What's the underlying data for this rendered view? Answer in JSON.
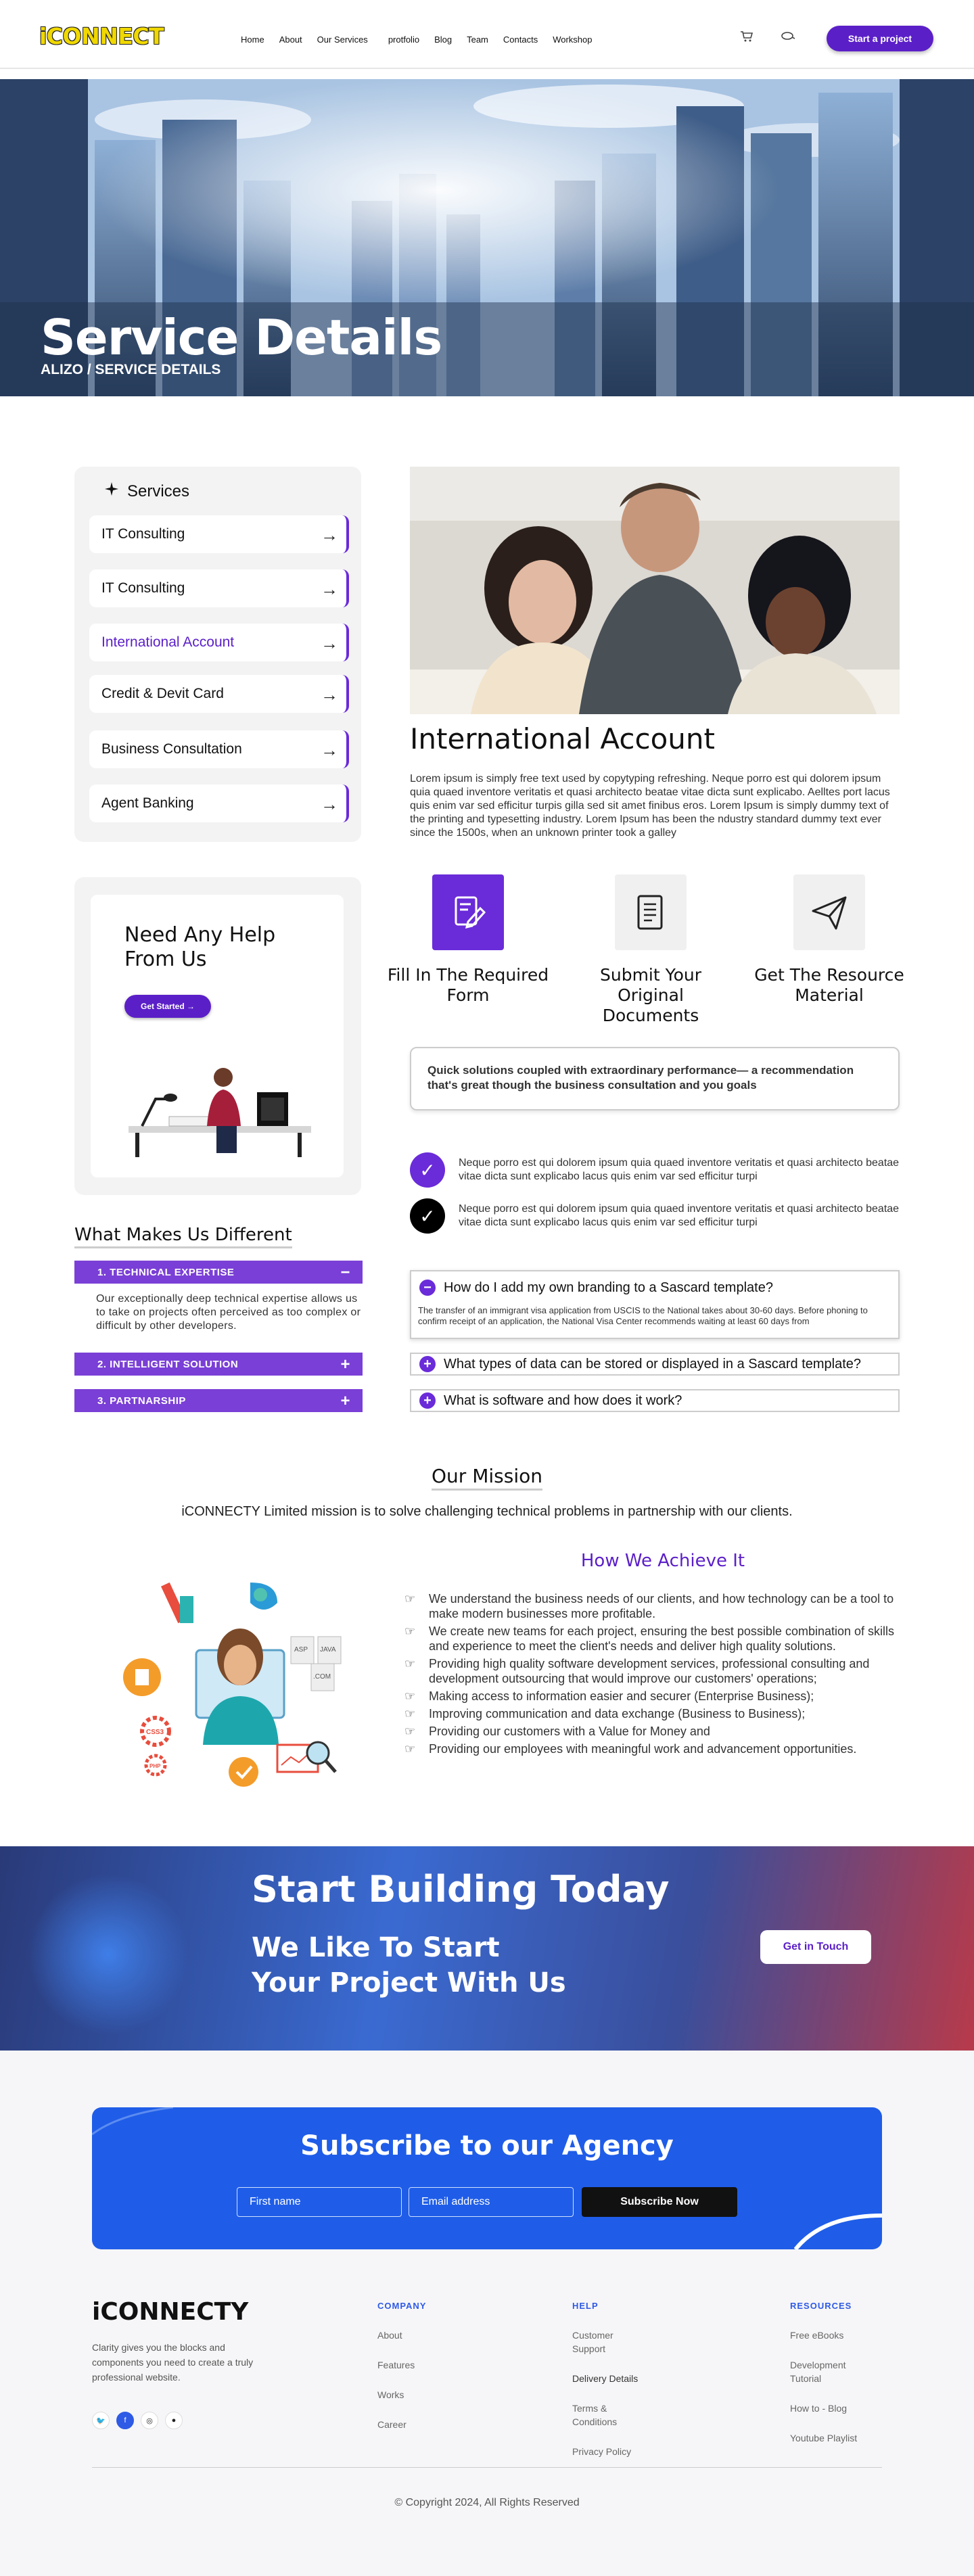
{
  "header": {
    "logo": "iCONNECT",
    "nav": [
      "Home",
      "About",
      "Our Services",
      "protfolio",
      "Blog",
      "Team",
      "Contacts",
      "Workshop"
    ],
    "cta": "Start a project",
    "icons": [
      "cart-icon",
      "search-icon"
    ]
  },
  "hero": {
    "title": "Service Details",
    "breadcrumb": "ALIZO / SERVICE DETAILS"
  },
  "services": {
    "title": "Services",
    "items": [
      {
        "label": "IT Consulting"
      },
      {
        "label": "IT Consulting"
      },
      {
        "label": "International Account",
        "active": true
      },
      {
        "label": "Credit & Devit Card"
      },
      {
        "label": "Business Consultation"
      },
      {
        "label": "Agent Banking"
      }
    ]
  },
  "help": {
    "title": "Need Any Help From Us",
    "button": "Get Started"
  },
  "main": {
    "title": "International Account",
    "paragraph": "Lorem ipsum is simply free text used by copytyping refreshing. Neque porro est qui dolorem ipsum quia quaed inventore veritatis et quasi architecto beatae vitae dicta sunt explicabo. Aelltes port lacus quis enim var sed efficitur turpis gilla sed sit amet finibus eros. Lorem Ipsum is simply dummy text of the printing and typesetting industry. Lorem Ipsum has been the ndustry standard dummy text ever since the 1500s, when an unknown printer took a galley",
    "steps": [
      {
        "title": "Fill In The Required Form",
        "icon": "form-icon"
      },
      {
        "title": "Submit Your Original Documents",
        "icon": "document-icon"
      },
      {
        "title": "Get The Resource Material",
        "icon": "paper-plane-icon"
      }
    ],
    "quote": "Quick solutions coupled with extraordinary performance— a recommendation that's great though the business consultation and you goals",
    "checks": [
      "Neque porro est qui dolorem ipsum quia quaed inventore veritatis et quasi architecto beatae vitae dicta sunt explicabo lacus quis enim var sed efficitur turpi",
      "Neque porro est qui dolorem ipsum quia quaed inventore veritatis et quasi architecto beatae vitae dicta sunt explicabo lacus quis enim var sed efficitur turpi"
    ],
    "faq": [
      {
        "q": "How do I add my own branding to a Sascard template?",
        "a": "The transfer of an immigrant visa application from USCIS to the National takes about 30-60 days. Before phoning to confirm receipt of an application, the National Visa Center recommends waiting at least 60 days from",
        "open": true
      },
      {
        "q": "What types of data can be stored or displayed in a Sascard template?"
      },
      {
        "q": "What is software and how does it work?"
      }
    ]
  },
  "different": {
    "title": "What Makes Us Different",
    "items": [
      {
        "label": "1.  TECHNICAL EXPERTISE",
        "open": true,
        "body": "Our exceptionally deep technical expertise allows us to take on projects often perceived as too complex or difficult by other developers."
      },
      {
        "label": "2.  INTELLIGENT SOLUTION"
      },
      {
        "label": "3.  PARTNARSHIP"
      }
    ]
  },
  "mission": {
    "title": "Our Mission",
    "text": "iCONNECTY Limited mission is to solve challenging technical problems in partnership with our clients.",
    "achieve_title": "How We Achieve It",
    "achieve": [
      "We understand the business needs of our clients, and how technology can be a tool to make modern businesses more profitable.",
      "We create new teams for each project, ensuring the best possible combination of skills and experience to meet the client's needs and deliver high quality solutions.",
      "Providing high quality software development services, professional consulting and development outsourcing that would improve our customers' operations;",
      "Making access to information easier and securer (Enterprise Business);",
      "Improving communication and data exchange (Business to Business);",
      "Providing our customers with a Value for Money and",
      "Providing our employees with meaningful work and advancement opportunities."
    ],
    "illustration_labels": [
      "ASP",
      "JAVA",
      ".COM",
      "CSS3",
      "PHP"
    ]
  },
  "banner": {
    "title": "Start Building Today",
    "subtitle": "We Like To Start Your Project With Us",
    "button": "Get in Touch"
  },
  "subscribe": {
    "title": "Subscribe to our Agency",
    "first_placeholder": "First name",
    "email_placeholder": "Email address",
    "button": "Subscribe Now"
  },
  "footer": {
    "logo": "iCONNECTY",
    "desc": "Clarity gives you the blocks and components you need to create a truly professional website.",
    "social": [
      "twitter-icon",
      "facebook-icon",
      "instagram-icon",
      "github-icon"
    ],
    "columns": [
      {
        "title": "COMPANY",
        "links": [
          "About",
          "Features",
          "Works",
          "Career"
        ]
      },
      {
        "title": "HELP",
        "links": [
          "Customer Support",
          "Delivery Details",
          "Terms & Conditions",
          "Privacy Policy"
        ]
      },
      {
        "title": "RESOURCES",
        "links": [
          "Free eBooks",
          "Development Tutorial",
          "How to - Blog",
          "Youtube Playlist"
        ]
      }
    ],
    "copyright": "© Copyright 2024, All Rights Reserved"
  },
  "colors": {
    "accent": "#5b1fc8",
    "subscribe_bg": "#1f5de8",
    "logo_yellow": "#f0d800"
  }
}
